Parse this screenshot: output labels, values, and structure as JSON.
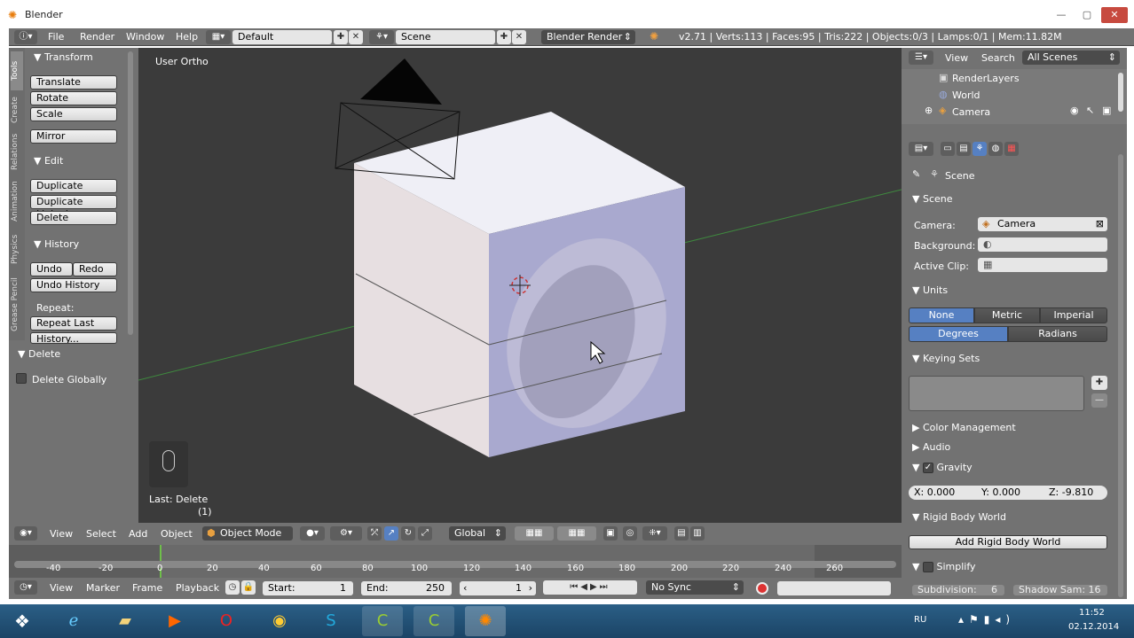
{
  "window": {
    "title": "Blender"
  },
  "infobar": {
    "menus": [
      "File",
      "Render",
      "Window",
      "Help"
    ],
    "screen_layout": "Default",
    "scene": "Scene",
    "render_engine": "Blender Render",
    "stats": "v2.71 | Verts:113 | Faces:95 | Tris:222 | Objects:0/3 | Lamps:0/1 | Mem:11.82M"
  },
  "tabs": [
    "Tools",
    "Create",
    "Relations",
    "Animation",
    "Physics",
    "Grease Pencil"
  ],
  "tools": {
    "transform": {
      "title": "Transform",
      "buttons": [
        "Translate",
        "Rotate",
        "Scale"
      ],
      "mirror": "Mirror"
    },
    "edit": {
      "title": "Edit",
      "buttons": [
        "Duplicate",
        "Duplicate Linked",
        "Delete"
      ]
    },
    "history": {
      "title": "History",
      "undo": "Undo",
      "redo": "Redo",
      "undo_history": "Undo History",
      "repeat_label": "Repeat:",
      "repeat_last": "Repeat Last",
      "history_btn": "History..."
    },
    "operator": {
      "title": "Delete",
      "option": "Delete Globally"
    }
  },
  "viewport": {
    "title": "User Ortho",
    "last_op": "Last: Delete",
    "frame_indicator": "(1)"
  },
  "vpheader": {
    "menus": [
      "View",
      "Select",
      "Add",
      "Object"
    ],
    "mode": "Object Mode",
    "orientation": "Global"
  },
  "timeline": {
    "ruler": [
      "-40",
      "-20",
      "0",
      "20",
      "40",
      "60",
      "80",
      "100",
      "120",
      "140",
      "160",
      "180",
      "200",
      "220",
      "240",
      "260"
    ],
    "menus": [
      "View",
      "Marker",
      "Frame",
      "Playback"
    ],
    "start_label": "Start:",
    "start": "1",
    "end_label": "End:",
    "end": "250",
    "current": "1",
    "sync": "No Sync"
  },
  "outliner": {
    "menus": [
      "View",
      "Search"
    ],
    "filter": "All Scenes",
    "items": [
      "RenderLayers",
      "World",
      "Camera"
    ]
  },
  "properties": {
    "breadcrumb": "Scene",
    "scene_panel": {
      "title": "Scene",
      "camera_label": "Camera:",
      "camera": "Camera",
      "background_label": "Background:",
      "clip_label": "Active Clip:"
    },
    "units": {
      "title": "Units",
      "systems": [
        "None",
        "Metric",
        "Imperial"
      ],
      "rotations": [
        "Degrees",
        "Radians"
      ]
    },
    "keying": {
      "title": "Keying Sets"
    },
    "color_mgmt": {
      "title": "Color Management"
    },
    "audio": {
      "title": "Audio"
    },
    "gravity": {
      "title": "Gravity",
      "x": "X: 0.000",
      "y": "Y: 0.000",
      "z": "Z: -9.810"
    },
    "rigid": {
      "title": "Rigid Body World",
      "button": "Add Rigid Body World"
    },
    "simplify": {
      "title": "Simplify",
      "subdivision": "Subdivision:",
      "subdivision_val": "6",
      "shadow": "Shadow Sam: 16"
    }
  },
  "tray": {
    "lang": "RU",
    "time": "11:52",
    "date": "02.12.2014"
  },
  "colors": {
    "panel": "#727272",
    "viewport": "#3b3b3b",
    "accent": "#5680c2",
    "close": "#c74a3f"
  }
}
